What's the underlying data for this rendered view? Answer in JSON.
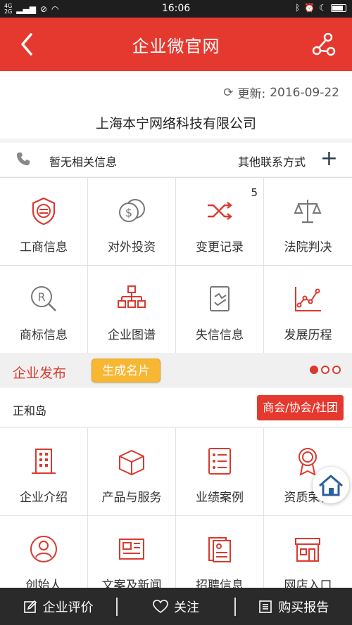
{
  "status_bar": {
    "network_top": "4G",
    "network_bottom": "2G",
    "time": "16:06"
  },
  "header": {
    "title": "企业微官网"
  },
  "info": {
    "updated_label": "更新:",
    "updated_date": "2016-09-22",
    "company_name": "上海本宁网络科技有限公司"
  },
  "contact": {
    "phone_text": "暂无相关信息",
    "other_label": "其他联系方式",
    "plus": "+"
  },
  "grid1": [
    {
      "label": "工商信息",
      "icon": "seal-icon"
    },
    {
      "label": "对外投资",
      "icon": "coins-icon"
    },
    {
      "label": "变更记录",
      "icon": "shuffle-icon",
      "badge": "5"
    },
    {
      "label": "法院判决",
      "icon": "scales-icon"
    },
    {
      "label": "商标信息",
      "icon": "trademark-icon"
    },
    {
      "label": "企业图谱",
      "icon": "org-chart-icon"
    },
    {
      "label": "失信信息",
      "icon": "broken-credit-icon"
    },
    {
      "label": "发展历程",
      "icon": "growth-chart-icon"
    }
  ],
  "publish": {
    "title": "企业发布",
    "generate_card": "生成名片"
  },
  "section": {
    "name": "正和岛",
    "association_button": "商会/协会/社团"
  },
  "grid2": [
    {
      "label": "企业介绍",
      "icon": "building-icon"
    },
    {
      "label": "产品与服务",
      "icon": "box-icon"
    },
    {
      "label": "业绩案例",
      "icon": "list-icon"
    },
    {
      "label": "资质荣誉",
      "icon": "award-icon"
    },
    {
      "label": "创始人",
      "icon": "person-icon"
    },
    {
      "label": "文案及新闻",
      "icon": "newspaper-icon"
    },
    {
      "label": "招聘信息",
      "icon": "resume-icon"
    },
    {
      "label": "网店入口",
      "icon": "shop-icon"
    }
  ],
  "footer": {
    "review": "企业评价",
    "follow": "关注",
    "buy_report": "购买报告"
  },
  "colors": {
    "brand_red": "#e5392f",
    "button_orange": "#f7b733",
    "footer_dark": "#2a2a2a"
  }
}
